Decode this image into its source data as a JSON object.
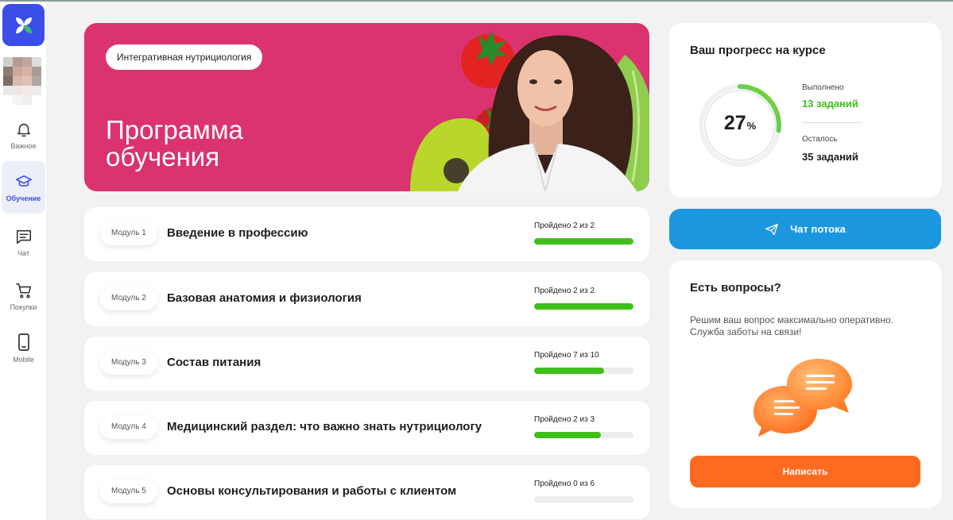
{
  "app": {
    "brand_color": "#3b4ee8"
  },
  "sidebar": {
    "items": [
      {
        "label": "Важное",
        "icon": "bell-icon"
      },
      {
        "label": "Обучение",
        "icon": "graduation-cap-icon",
        "active": true
      },
      {
        "label": "Чат",
        "icon": "chat-icon"
      },
      {
        "label": "Покупки",
        "icon": "cart-icon"
      },
      {
        "label": "Mobile",
        "icon": "phone-icon"
      }
    ]
  },
  "hero": {
    "tag": "Интегративная нутрициология",
    "title": "Программа обучения",
    "background": "#da336f"
  },
  "modules": [
    {
      "badge": "Модуль 1",
      "title": "Введение в профессию",
      "status": "Пройдено 2 из 2",
      "progress": 1.0
    },
    {
      "badge": "Модуль 2",
      "title": "Базовая анатомия и физиология",
      "status": "Пройдено 2 из 2",
      "progress": 1.0
    },
    {
      "badge": "Модуль 3",
      "title": "Состав питания",
      "status": "Пройдено 7 из 10",
      "progress": 0.7
    },
    {
      "badge": "Модуль 4",
      "title": "Медицинский раздел: что важно знать нутрициологу",
      "status": "Пройдено 2 из 3",
      "progress": 0.67
    },
    {
      "badge": "Модуль 5",
      "title": "Основы консультирования и работы с клиентом",
      "status": "Пройдено 0 из 6",
      "progress": 0.0
    }
  ],
  "progress_card": {
    "title": "Ваш прогресс на курсе",
    "percent": "27",
    "percent_sign": "%",
    "percent_value": 0.27,
    "done_label": "Выполнено",
    "done_value": "13 заданий",
    "left_label": "Осталось",
    "left_value": "35 заданий",
    "done_color": "#3fbf1b"
  },
  "chat_button": {
    "label": "Чат потока",
    "color": "#1a97df"
  },
  "help_card": {
    "title": "Есть вопросы?",
    "text": "Решим ваш вопрос максимально оперативно. Служба заботы на связи!",
    "button_label": "Написать",
    "button_color": "#ff6a21"
  }
}
